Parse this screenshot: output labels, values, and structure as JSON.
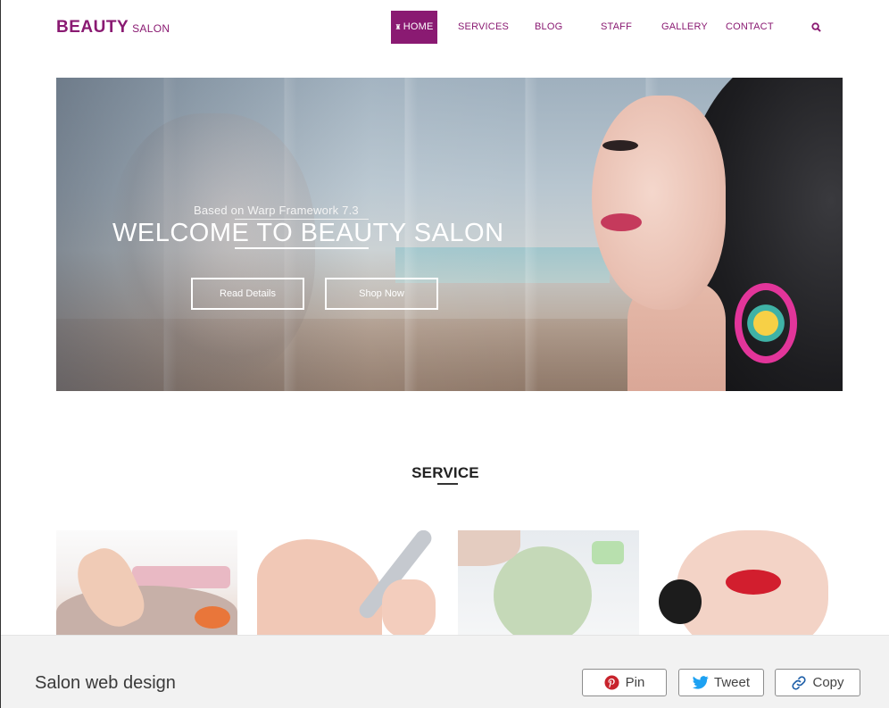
{
  "header": {
    "logo_main": "BEAUTY",
    "logo_sub": "SALON",
    "nav": [
      {
        "label": "HOME",
        "active": true
      },
      {
        "label": "SERVICES",
        "active": false
      },
      {
        "label": "BLOG",
        "active": false
      },
      {
        "label": "STAFF",
        "active": false
      },
      {
        "label": "GALLERY",
        "active": false
      },
      {
        "label": "CONTACT",
        "active": false
      }
    ],
    "search_icon": "search-icon"
  },
  "hero": {
    "subtitle": "Based on Warp Framework 7.3",
    "title": "WELCOME TO BEAUTY SALON",
    "buttons": [
      "Read Details",
      "Shop Now"
    ]
  },
  "service": {
    "title": "SERVICE",
    "cards": [
      "pedicure",
      "manicure",
      "facial",
      "makeup"
    ]
  },
  "footer": {
    "title": "Salon web design",
    "buttons": [
      {
        "label": "Pin",
        "icon": "pinterest-icon"
      },
      {
        "label": "Tweet",
        "icon": "twitter-icon"
      },
      {
        "label": "Copy",
        "icon": "link-icon"
      }
    ]
  },
  "colors": {
    "brand": "#8a1a72",
    "footer_bg": "#f2f2f2",
    "pinterest": "#c8232c",
    "twitter": "#1da1f2",
    "link": "#1e5fa8"
  }
}
